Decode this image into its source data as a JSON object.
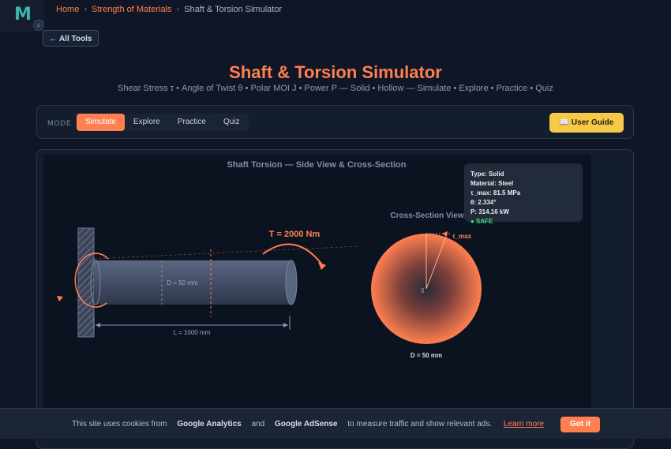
{
  "logo": {
    "letter": "M",
    "home_icon": "home-icon"
  },
  "breadcrumb": {
    "home": "Home",
    "category": "Strength of Materials",
    "current": "Shaft & Torsion Simulator",
    "separator": "›"
  },
  "back_button": "← All Tools",
  "page": {
    "title": "Shaft & Torsion Simulator",
    "subtitle": "Shear Stress τ • Angle of Twist θ • Polar MOI J • Power P — Solid • Hollow — Simulate • Explore • Practice • Quiz"
  },
  "modebar": {
    "label": "MODE",
    "modes": [
      "Simulate",
      "Explore",
      "Practice",
      "Quiz"
    ],
    "active": "Simulate",
    "guide": "📖 User Guide"
  },
  "diagram": {
    "title": "Shaft Torsion — Side View & Cross-Section",
    "torque": "T = 2000 Nm",
    "diameter": "D = 50 mm",
    "length": "L = 1000 mm",
    "cross_title": "Cross-Section View",
    "center": "0",
    "tau_label": "τ_max",
    "cross_diameter": "D = 50 mm",
    "colors": {
      "accent": "#ff7f50",
      "shaft": "#4a5570",
      "wall": "#5a6478"
    }
  },
  "tooltip": {
    "type": "Type: Solid",
    "material": "Material: Steel",
    "tau": "τ_max: 81.5 MPa",
    "theta": "θ: 2.334°",
    "power": "P: 314.16 kW",
    "status": "● SAFE"
  },
  "cookie": {
    "prefix": "This site uses cookies from",
    "ga": "Google Analytics",
    "and": "and",
    "adsense": "Google AdSense",
    "suffix": "to measure traffic and show relevant ads.",
    "learn": "Learn more",
    "button": "Got it"
  }
}
